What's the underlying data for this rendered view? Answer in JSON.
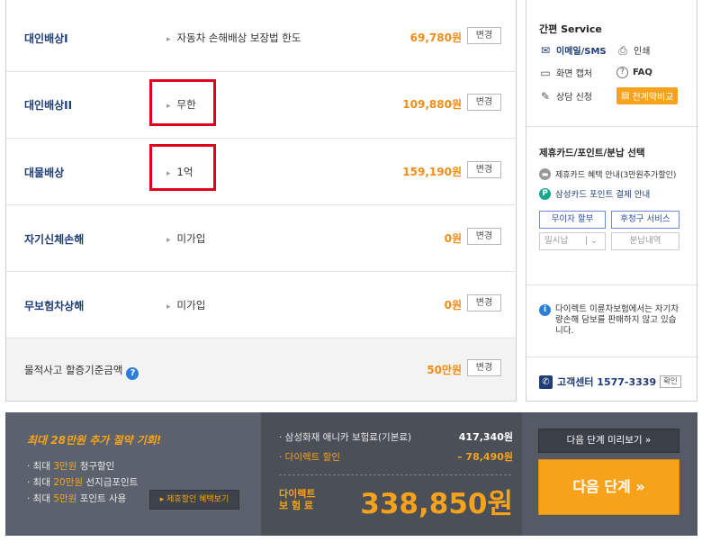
{
  "coverage": [
    {
      "name": "대인배상I",
      "detail": "자동차 손해배상 보장법 한도",
      "price": "69,780원",
      "change": "변경"
    },
    {
      "name": "대인배상II",
      "detail": "무한",
      "price": "109,880원",
      "change": "변경"
    },
    {
      "name": "대물배상",
      "detail": "1억",
      "price": "159,190원",
      "change": "변경"
    },
    {
      "name": "자기신체손해",
      "detail": "미가입",
      "price": "0원",
      "change": "변경"
    },
    {
      "name": "무보험차상해",
      "detail": "미가입",
      "price": "0원",
      "change": "변경"
    }
  ],
  "deductible": {
    "label": "물적사고 할증기준금액",
    "help": "?",
    "price": "50만원",
    "change": "변경"
  },
  "side": {
    "service_title": "간편 Service",
    "email": "이메일/SMS",
    "print": "인쇄",
    "capture": "화면 캡처",
    "faq": "FAQ",
    "consult": "상담 신청",
    "compare": "전계약비교",
    "card_title": "제휴카드/포인트/분납 선택",
    "card_info": "제휴카드 혜택 안내(3만원추가할인)",
    "samsung_point": "삼성카드 포인트 결제 안내",
    "no_interest": "무이자 할부",
    "post_claim": "후청구 서비스",
    "lump_sum": "일시납",
    "installment": "분납내역",
    "notice": "다이렉트 이륜차보험에서는 자기차량손해 담보를 판매하지 않고 있습니다.",
    "call_center": "고객센터 1577-3339",
    "confirm": "확인"
  },
  "bottom": {
    "promo_title": "최대 28만원 추가 절약 기회!",
    "promo_lines": [
      {
        "prefix": "· 최대 ",
        "highlight": "3만원",
        "suffix": " 청구할인"
      },
      {
        "prefix": "· 최대 ",
        "highlight": "20만원",
        "suffix": " 선지급포인트"
      },
      {
        "prefix": "· 최대 ",
        "highlight": "5만원",
        "suffix": " 포인트 사용"
      }
    ],
    "promo_button": "▸ 제휴할인 혜택보기",
    "base_label": "· 삼성화재 애니카 보험료(기본료)",
    "base_value": "417,340원",
    "discount_label": "· 다이렉트 할인",
    "discount_value": "– 78,490원",
    "total_label_1": "다이렉트",
    "total_label_2": "보 험 료",
    "total_value": "338,850원",
    "preview_button": "다음 단계 미리보기 »",
    "next_button": "다음 단계 »"
  }
}
